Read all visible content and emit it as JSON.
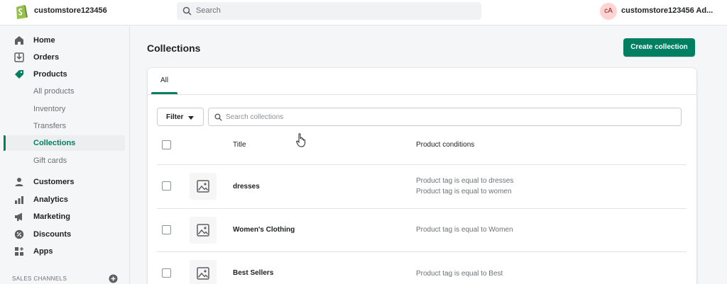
{
  "topbar": {
    "store_name": "customstore123456",
    "search_placeholder": "Search",
    "avatar_initials": "cA",
    "account_label": "customstore123456 Ad..."
  },
  "sidebar": {
    "home": "Home",
    "orders": "Orders",
    "products": "Products",
    "all_products": "All products",
    "inventory": "Inventory",
    "transfers": "Transfers",
    "collections": "Collections",
    "gift_cards": "Gift cards",
    "customers": "Customers",
    "analytics": "Analytics",
    "marketing": "Marketing",
    "discounts": "Discounts",
    "apps": "Apps",
    "sales_channels": "SALES CHANNELS"
  },
  "page": {
    "title": "Collections",
    "create_button": "Create collection"
  },
  "tabs": {
    "all": "All"
  },
  "toolbar": {
    "filter_label": "Filter",
    "search_placeholder": "Search collections"
  },
  "table": {
    "headers": {
      "title": "Title",
      "conditions": "Product conditions"
    },
    "rows": [
      {
        "title": "dresses",
        "cond1": "Product tag is equal to dresses",
        "cond2": "Product tag is equal to women"
      },
      {
        "title": "Women's Clothing",
        "cond1": "Product tag is equal to Women"
      },
      {
        "title": "Best Sellers",
        "cond1": "Product tag is equal to Best"
      }
    ]
  },
  "colors": {
    "accent": "#008060",
    "avatar_bg": "#fed3d1"
  }
}
